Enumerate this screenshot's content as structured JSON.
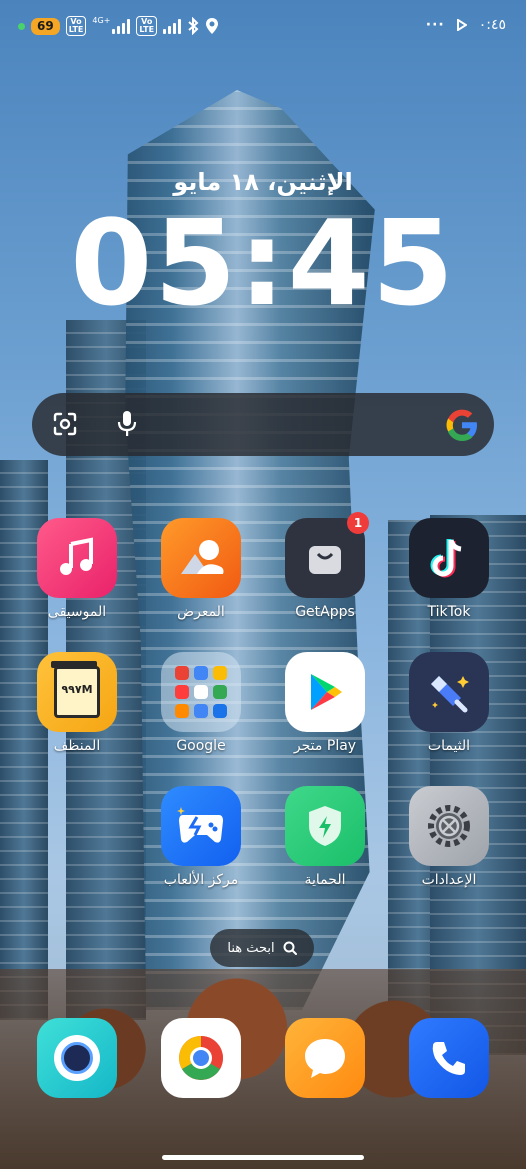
{
  "status_bar": {
    "battery": "69",
    "network_gen": "4G+",
    "volte": "Vo LTE",
    "more": "···",
    "time": "٠:٤٥"
  },
  "lock": {
    "date": "الإثنين، ١٨ مايو",
    "clock": "05:45"
  },
  "search_bar": {
    "google_letter": "G"
  },
  "apps": {
    "music": "الموسيقى",
    "gallery": "المعرض",
    "getapps": "GetApps",
    "getapps_badge": "1",
    "tiktok": "TikTok",
    "cleaner": "المنظف",
    "cleaner_value": "٩٩٧M",
    "google": "Google",
    "play": "متجر Play",
    "themes": "الثيمات",
    "games": "مركز الألعاب",
    "security": "الحماية",
    "settings": "الإعدادات"
  },
  "home_search": {
    "label": "ابحث هنا"
  },
  "colors": {
    "battery": "#f4a624",
    "badge": "#f03b3b",
    "search_bg": "#2a2c30"
  }
}
